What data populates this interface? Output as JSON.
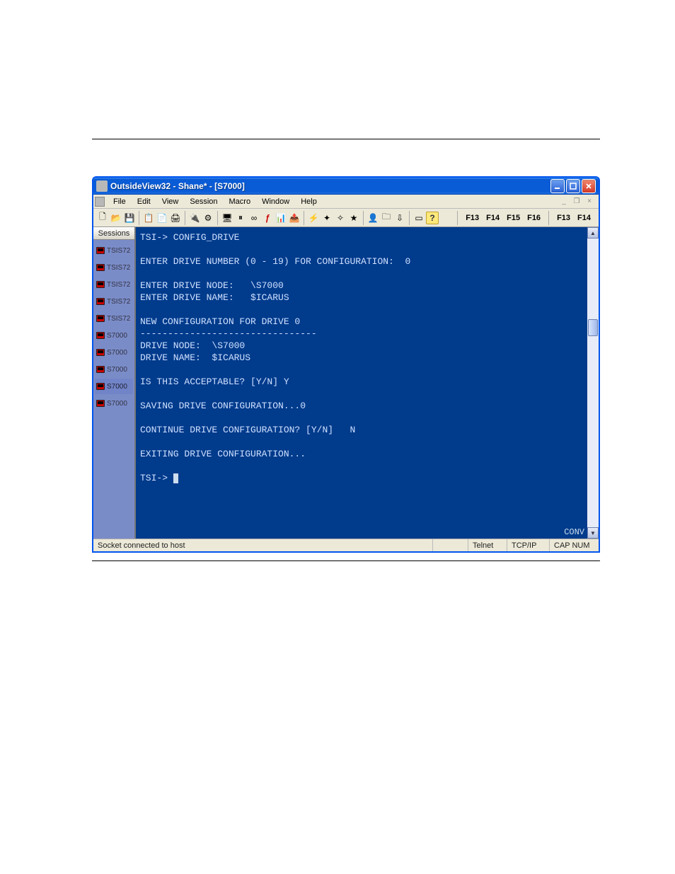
{
  "window": {
    "title": "OutsideView32 - Shane* - [S7000]",
    "controls": {
      "min": "_",
      "max": "❐",
      "close": "X"
    }
  },
  "menu": {
    "items": [
      "File",
      "Edit",
      "View",
      "Session",
      "Macro",
      "Window",
      "Help"
    ],
    "mdi": {
      "min": "_",
      "restore": "❐",
      "close": "×"
    }
  },
  "toolbar": {
    "buttons": {
      "new": "🗋",
      "open": "📂",
      "save": "💾",
      "copy": "📋",
      "paste": "📄",
      "print": "🖨",
      "connect": "🔌",
      "config": "⚙",
      "screen": "🖥",
      "pause": "⏸",
      "binary": "∞",
      "script": "ƒ",
      "chart": "📊",
      "send": "📤",
      "hot1": "⚡",
      "hot2": "✦",
      "hot3": "✧",
      "hot4": "★",
      "user": "👤",
      "folder": "🗀",
      "load": "⇩",
      "win": "▭",
      "help": "?"
    },
    "fkeys_left": [
      "F13",
      "F14",
      "F15",
      "F16"
    ],
    "fkeys_right": [
      "F13",
      "F14"
    ]
  },
  "sidebar": {
    "header": "Sessions",
    "items": [
      {
        "label": "TSIS72",
        "active": false
      },
      {
        "label": "TSIS72",
        "active": false
      },
      {
        "label": "TSIS72",
        "active": false
      },
      {
        "label": "TSIS72",
        "active": false
      },
      {
        "label": "TSIS72",
        "active": false
      },
      {
        "label": "S7000",
        "active": false
      },
      {
        "label": "S7000",
        "active": false
      },
      {
        "label": "S7000",
        "active": false
      },
      {
        "label": "S7000",
        "active": true
      },
      {
        "label": "S7000",
        "active": false
      }
    ]
  },
  "terminal": {
    "lines": [
      "TSI-> CONFIG_DRIVE",
      "",
      "ENTER DRIVE NUMBER (0 - 19) FOR CONFIGURATION:  0",
      "",
      "ENTER DRIVE NODE:   \\S7000",
      "ENTER DRIVE NAME:   $ICARUS",
      "",
      "NEW CONFIGURATION FOR DRIVE 0",
      "--------------------------------",
      "DRIVE NODE:  \\S7000",
      "DRIVE NAME:  $ICARUS",
      "",
      "IS THIS ACCEPTABLE? [Y/N] Y",
      "",
      "SAVING DRIVE CONFIGURATION...0",
      "",
      "CONTINUE DRIVE CONFIGURATION? [Y/N]   N",
      "",
      "EXITING DRIVE CONFIGURATION...",
      "",
      "TSI-> "
    ],
    "status_right": "CONV"
  },
  "statusbar": {
    "message": "Socket connected to host",
    "conn_type": "Telnet",
    "protocol": "TCP/IP",
    "indicators": "CAP  NUM"
  }
}
